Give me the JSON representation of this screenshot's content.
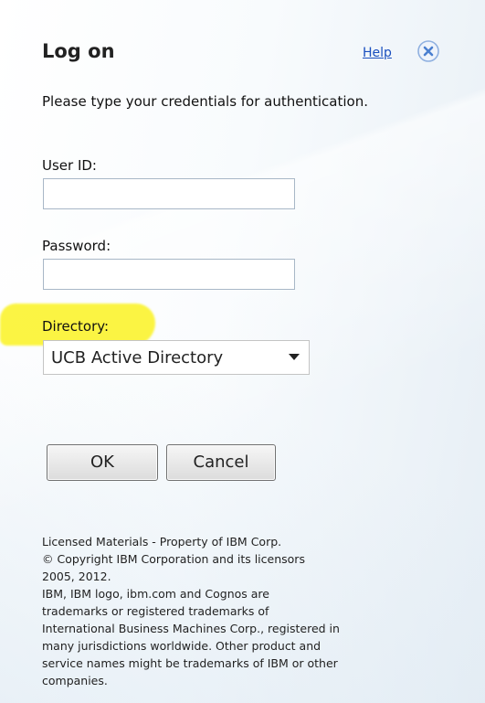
{
  "dialog": {
    "title": "Log on",
    "help_label": "Help",
    "close_icon": "close-circle-icon",
    "instructions": "Please type your credentials for authentication."
  },
  "form": {
    "user_id_label": "User ID:",
    "user_id_value": "",
    "password_label": "Password:",
    "password_value": "",
    "directory_label": "Directory:",
    "directory_selected": "UCB Active Directory",
    "directory_highlight_color": "#fbf43a"
  },
  "buttons": {
    "ok_label": "OK",
    "cancel_label": "Cancel"
  },
  "legal": {
    "lines": [
      "Licensed Materials - Property of IBM Corp.",
      "© Copyright IBM Corporation and its licensors",
      "2005, 2012.",
      "IBM, IBM logo, ibm.com and Cognos are",
      "trademarks or registered trademarks of",
      "International Business Machines Corp., registered in",
      "many jurisdictions worldwide. Other product and",
      "service names might be trademarks of IBM or other",
      "companies."
    ]
  },
  "colors": {
    "link": "#1a4fbf",
    "close_icon": "#4a7fd0"
  }
}
